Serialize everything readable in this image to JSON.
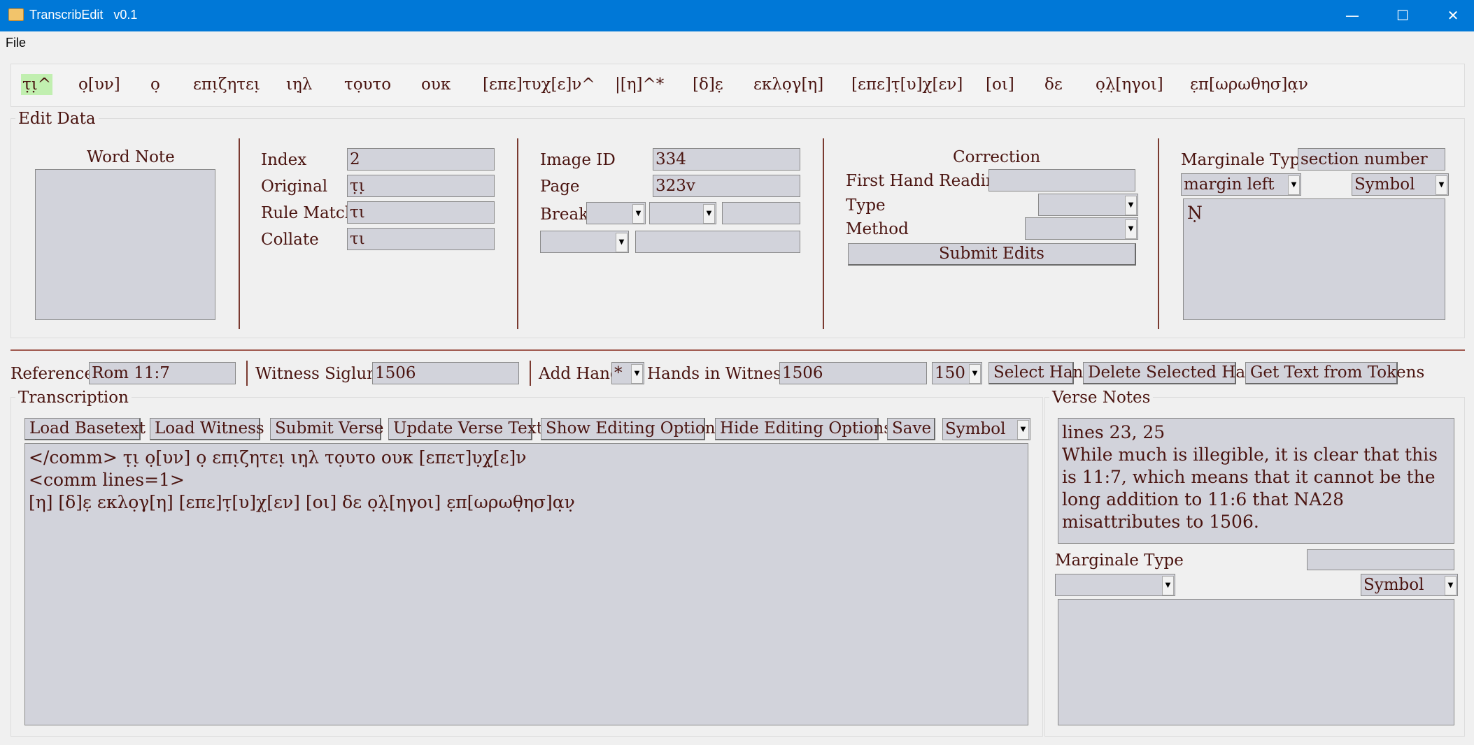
{
  "window": {
    "title": "TranscribEdit   v0.1",
    "minimize_glyph": "—",
    "maximize_glyph": "☐",
    "close_glyph": "✕"
  },
  "menu": {
    "file_label": "File"
  },
  "tokens": [
    {
      "text": "τ̣ι̣^",
      "selected": true
    },
    {
      "text": "ο̣[υν]"
    },
    {
      "text": "ο̣"
    },
    {
      "text": "επι̣ζητει̣"
    },
    {
      "text": "ιη̣λ"
    },
    {
      "text": "το̣υτο"
    },
    {
      "text": "ουκ"
    },
    {
      "text": "[επε]τυχ[ε]ν^"
    },
    {
      "text": "|[η]^*"
    },
    {
      "text": "[δ]ε̣"
    },
    {
      "text": "εκλο̣γ[η]"
    },
    {
      "text": "[επε]τ̣[υ]χ[εν]"
    },
    {
      "text": "[οι]"
    },
    {
      "text": "δε"
    },
    {
      "text": "ο̣λ̣[ηγοι]"
    },
    {
      "text": "ε̣π[ωρωθησ]α̣ν"
    }
  ],
  "edit_data": {
    "group_label": "Edit Data",
    "word_note": {
      "label": "Word Note",
      "value": ""
    },
    "index": {
      "label": "Index",
      "value": "2"
    },
    "original": {
      "label": "Original",
      "value": "τ̣ι̣"
    },
    "rule_match": {
      "label": "Rule Match",
      "value": "τι"
    },
    "collate": {
      "label": "Collate",
      "value": "τι"
    },
    "image_id": {
      "label": "Image ID",
      "value": "334"
    },
    "page": {
      "label": "Page",
      "value": "323v"
    },
    "break": {
      "label": "Break",
      "value1": "",
      "value2": "",
      "value3": "",
      "value4": "",
      "value5": ""
    },
    "correction": {
      "label": "Correction",
      "first_hand_label": "First Hand Reading",
      "first_hand_value": "",
      "type_label": "Type",
      "type_value": "",
      "method_label": "Method",
      "method_value": "",
      "submit_label": "Submit Edits"
    },
    "marginale": {
      "type_label": "Marginale Type",
      "type_value": "section number",
      "position_value": "margin left",
      "symbol_value": "Symbol",
      "text": "Ṇ"
    }
  },
  "verse_bar": {
    "reference_label": "Reference",
    "reference_value": "Rom 11:7",
    "siglum_label": "Witness Siglum",
    "siglum_value": "1506",
    "add_hand_label": "Add Hand",
    "add_hand_value": "*",
    "hands_label": "Hands in Witness:",
    "hands_value": "1506",
    "hand_select_value": "150",
    "select_hand_label": "Select Hand",
    "delete_hand_label": "Delete Selected Hand",
    "get_text_label": "Get Text from Tokens"
  },
  "transcription": {
    "group_label": "Transcription",
    "buttons": {
      "load_basetext": "Load Basetext",
      "load_witness": "Load Witness",
      "submit_verse": "Submit Verse",
      "update_verse": "Update Verse Text",
      "show_options": "Show Editing Options",
      "hide_options": "Hide Editing Options",
      "save": "Save"
    },
    "symbol_value": "Symbol",
    "lines": [
      "</comm> τ̣ι̣ ο̣[υν] ο̣ επι̣ζητει̣ ιη̣λ το̣υτο ουκ [επετ]υ̣χ̣[ε]ν",
      "<comm lines=1>",
      "[η] [δ]ε̣ εκλο̣γ[η] [επε]τ̣[υ]χ[εν] [οι] δε ο̣λ̣[ηγοι] ε̣π[ωρωθ̣ησ]α̣ν̣"
    ]
  },
  "verse_notes": {
    "group_label": "Verse Notes",
    "text_line1": "lines 23, 25",
    "text_body": "While much is illegible, it is clear that this is 11:7, which means that it cannot be the long addition to 11:6 that NA28 misattributes to 1506.",
    "marginale_type_label": "Marginale Type",
    "marginale_type_value": "",
    "marginale_select_value": "",
    "symbol_value": "Symbol",
    "marginale_text": ""
  }
}
